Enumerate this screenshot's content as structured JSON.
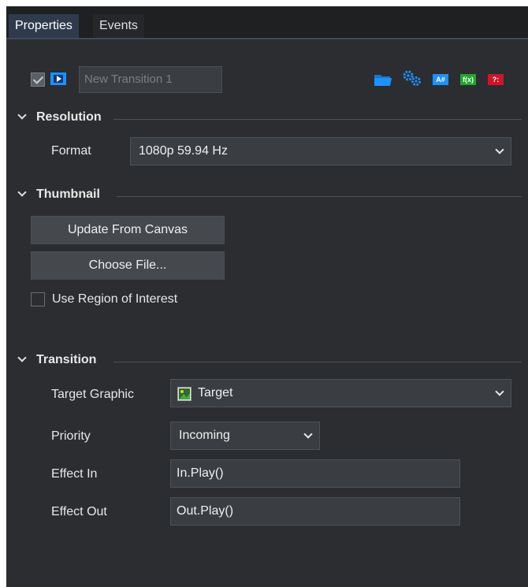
{
  "tabs": {
    "properties": "Properties",
    "events": "Events"
  },
  "object": {
    "enabled": true,
    "name": "New Transition 1"
  },
  "toolbar_icons": [
    {
      "name": "folder-icon",
      "color": "#1e90ff"
    },
    {
      "name": "settings-gears-icon",
      "color": "#1e90ff"
    },
    {
      "name": "a-hash-icon",
      "color": "#1e90ff",
      "text": "A#"
    },
    {
      "name": "fx-icon",
      "color": "#1fa82b",
      "text": "f(x)"
    },
    {
      "name": "help-icon",
      "color": "#d0142a",
      "text": "?:"
    }
  ],
  "resolution": {
    "header": "Resolution",
    "format_label": "Format",
    "format_value": "1080p 59.94 Hz"
  },
  "thumbnail": {
    "header": "Thumbnail",
    "update_button": "Update From Canvas",
    "choose_button": "Choose File...",
    "roi_label": "Use Region of Interest",
    "roi_checked": false
  },
  "transition": {
    "header": "Transition",
    "target_label": "Target Graphic",
    "target_value": "Target",
    "priority_label": "Priority",
    "priority_value": "Incoming",
    "effect_in_label": "Effect In",
    "effect_in_value": "In.Play()",
    "effect_out_label": "Effect Out",
    "effect_out_value": "Out.Play()"
  }
}
